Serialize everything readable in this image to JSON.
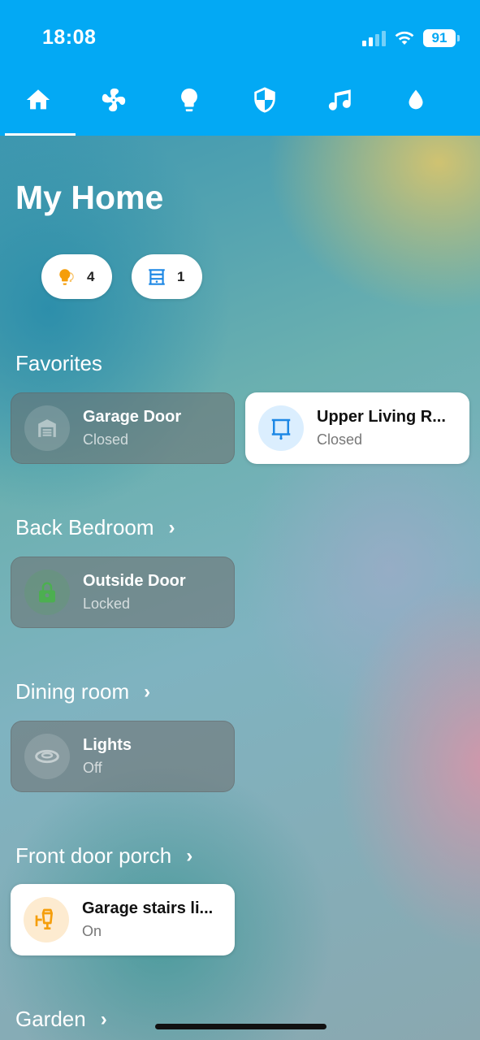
{
  "status_bar": {
    "time": "18:08",
    "battery": "91"
  },
  "nav": {
    "tabs": [
      {
        "icon": "home-icon",
        "active": true
      },
      {
        "icon": "fan-icon",
        "active": false
      },
      {
        "icon": "lightbulb-icon",
        "active": false
      },
      {
        "icon": "shield-icon",
        "active": false
      },
      {
        "icon": "music-icon",
        "active": false
      },
      {
        "icon": "water-drop-icon",
        "active": false
      }
    ]
  },
  "page": {
    "title": "My Home"
  },
  "summary_chips": [
    {
      "icon": "lights-icon",
      "count": "4",
      "color": "#f59e0b"
    },
    {
      "icon": "blinds-icon",
      "count": "1",
      "color": "#1e88e5"
    }
  ],
  "sections": {
    "favorites": {
      "title": "Favorites",
      "cards": [
        {
          "name": "Garage Door",
          "state": "Closed",
          "icon": "garage-icon"
        },
        {
          "name": "Upper Living R...",
          "state": "Closed",
          "icon": "blind-icon",
          "color": "#1e88e5"
        }
      ]
    },
    "back_bedroom": {
      "title": "Back Bedroom",
      "chevron": "›",
      "cards": [
        {
          "name": "Outside Door",
          "state": "Locked",
          "icon": "lock-icon",
          "color": "#4caf50"
        }
      ]
    },
    "dining_room": {
      "title": "Dining room",
      "chevron": "›",
      "cards": [
        {
          "name": "Lights",
          "state": "Off",
          "icon": "ceiling-light-icon"
        }
      ]
    },
    "front_door_porch": {
      "title": "Front door porch",
      "chevron": "›",
      "cards": [
        {
          "name": "Garage stairs li...",
          "state": "On",
          "icon": "outdoor-lamp-icon",
          "color": "#f59e0b"
        }
      ]
    },
    "garden": {
      "title": "Garden",
      "chevron": "›"
    }
  },
  "colors": {
    "header": "#03a9f4",
    "accent_orange": "#f59e0b",
    "accent_blue": "#1e88e5",
    "accent_green": "#4caf50"
  }
}
